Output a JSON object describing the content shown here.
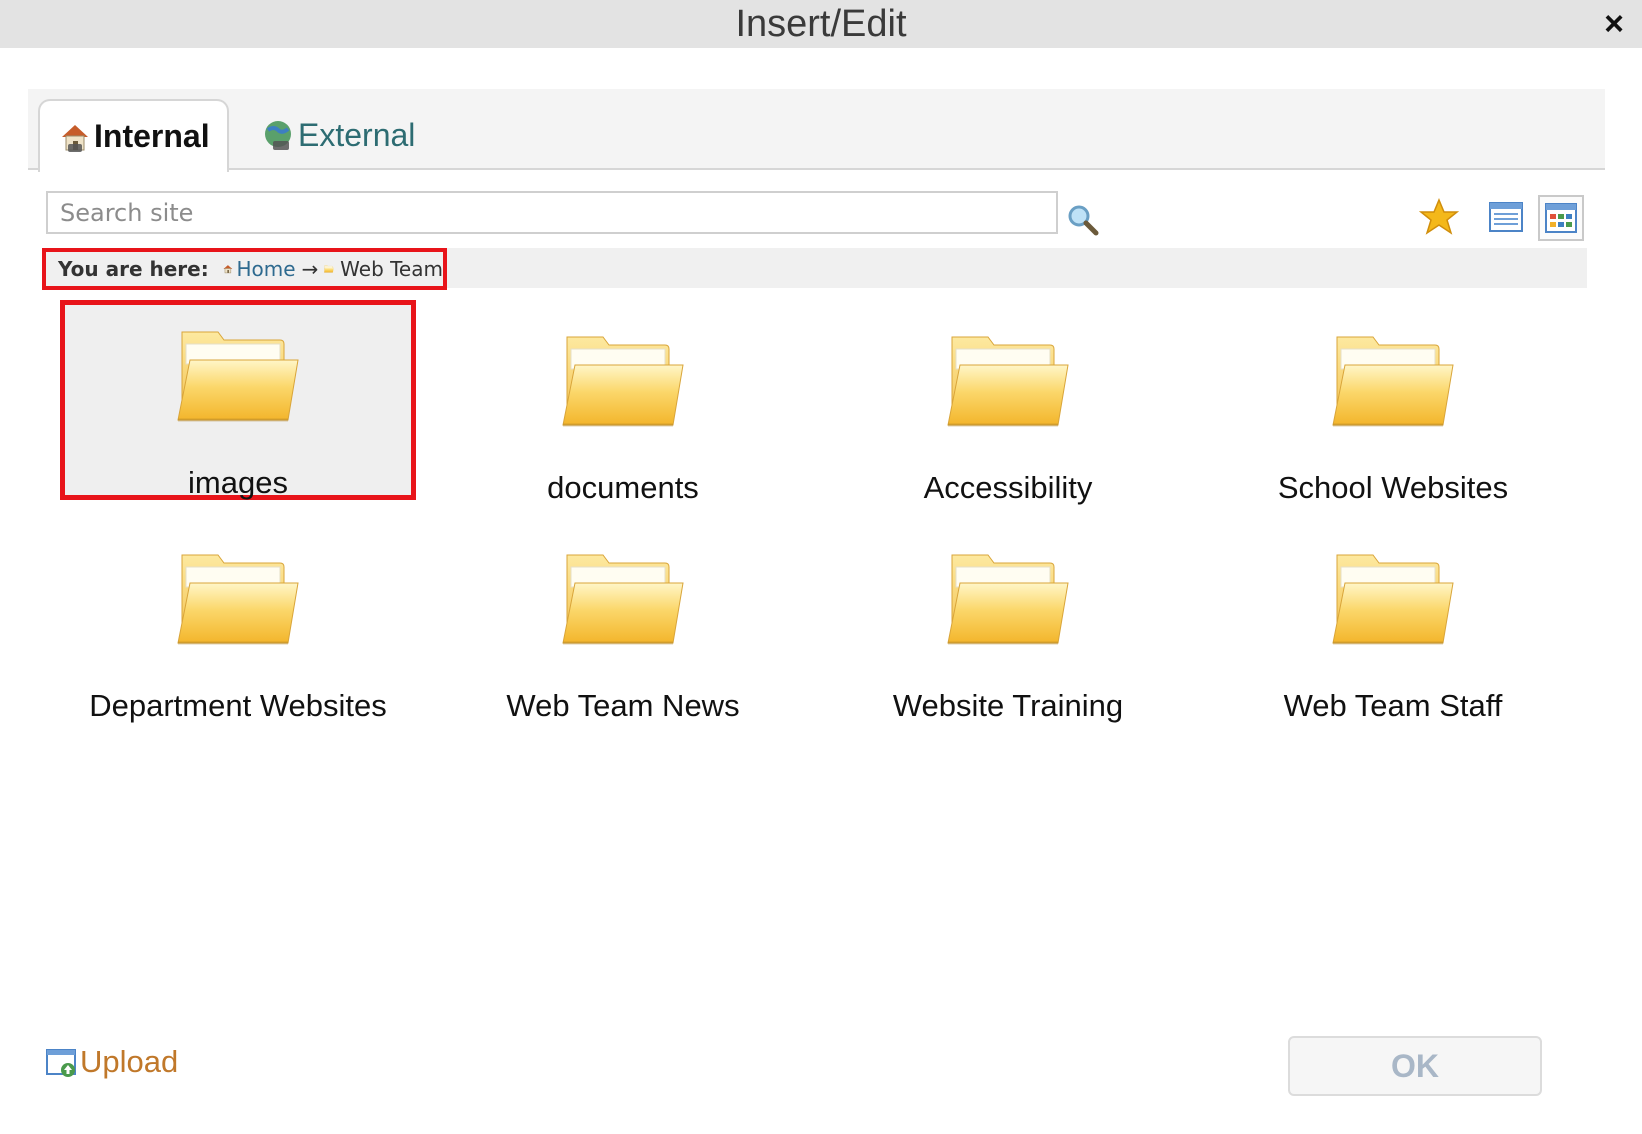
{
  "dialog": {
    "title": "Insert/Edit",
    "close_label": "×"
  },
  "tabs": [
    {
      "label": "Internal",
      "icon": "home-link-icon",
      "active": true
    },
    {
      "label": "External",
      "icon": "globe-link-icon",
      "active": false
    }
  ],
  "search": {
    "placeholder": "Search site",
    "value": ""
  },
  "toolbar": {
    "favorites_icon": "star-icon",
    "list_view_icon": "list-view-icon",
    "grid_view_icon": "grid-view-icon",
    "active_view": "grid"
  },
  "breadcrumb": {
    "label": "You are here:",
    "home": "Home",
    "separator": "→",
    "current": "Web Team"
  },
  "folders": [
    {
      "name": "images",
      "selected": true
    },
    {
      "name": "documents",
      "selected": false
    },
    {
      "name": "Accessibility",
      "selected": false
    },
    {
      "name": "School Websites",
      "selected": false
    },
    {
      "name": "Department Websites",
      "selected": false
    },
    {
      "name": "Web Team News",
      "selected": false
    },
    {
      "name": "Website Training",
      "selected": false
    },
    {
      "name": "Web Team Staff",
      "selected": false
    }
  ],
  "footer": {
    "upload_label": "Upload",
    "ok_label": "OK"
  },
  "colors": {
    "highlight": "#e8141a",
    "link": "#2e6a8f",
    "upload": "#c0782a",
    "folder": "#f8c84a"
  }
}
